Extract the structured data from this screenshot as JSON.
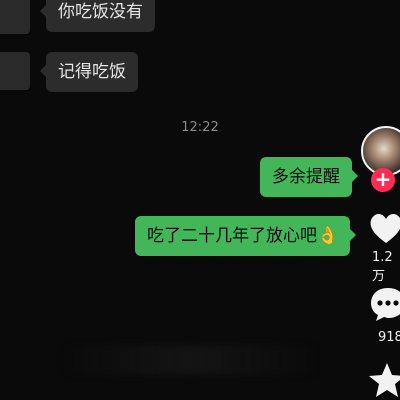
{
  "chat": {
    "messages": [
      {
        "side": "left",
        "text": "你吃饭没有"
      },
      {
        "side": "left",
        "text": "记得吃饭"
      },
      {
        "side": "right",
        "text": "多余提醒"
      },
      {
        "side": "right",
        "text": "吃了二十几年了放心吧👌"
      }
    ],
    "timestamp": "12:22"
  },
  "sidebar": {
    "like_count": "1.2万",
    "comment_count": "918"
  },
  "icons": {
    "follow": "plus-icon",
    "like": "heart-icon",
    "comment": "comment-icon",
    "favorite": "star-icon"
  },
  "colors": {
    "outgoing_bubble": "#43b65a",
    "incoming_bubble": "#2c2c2c",
    "follow_badge": "#fe2c55"
  }
}
